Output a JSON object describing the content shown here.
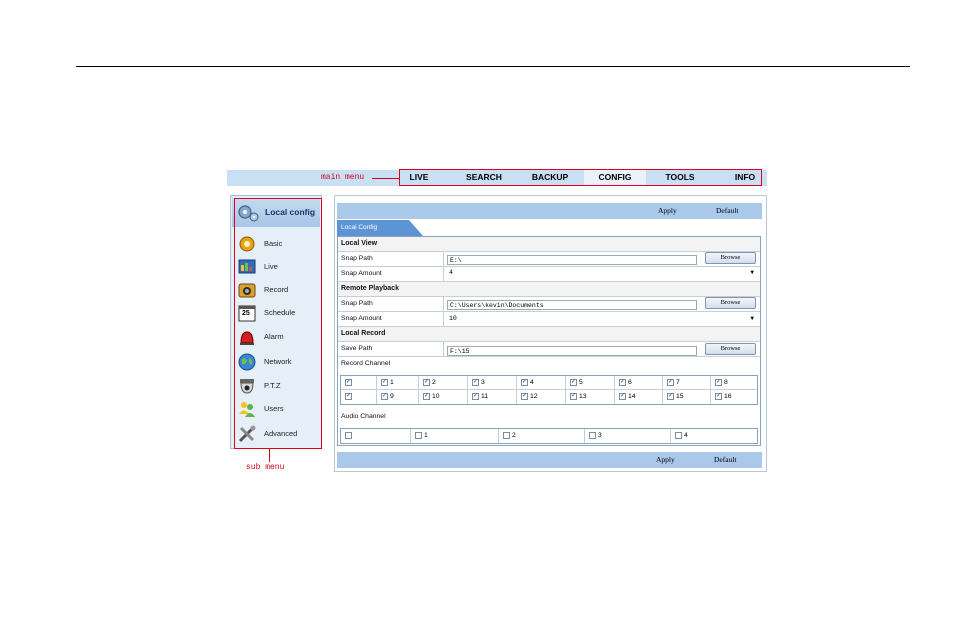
{
  "annotations": {
    "main_menu": "main menu",
    "sub_menu": "sub menu"
  },
  "main_menu": [
    {
      "label": "LIVE"
    },
    {
      "label": "SEARCH"
    },
    {
      "label": "BACKUP"
    },
    {
      "label": "CONFIG",
      "active": true
    },
    {
      "label": "TOOLS"
    },
    {
      "label": "INFO"
    }
  ],
  "sidebar": {
    "header": "Local config",
    "items": [
      {
        "label": "Basic",
        "icon": "gear-icon"
      },
      {
        "label": "Live",
        "icon": "monitor-icon"
      },
      {
        "label": "Record",
        "icon": "camera-icon"
      },
      {
        "label": "Schedule",
        "icon": "calendar-icon"
      },
      {
        "label": "Alarm",
        "icon": "siren-icon"
      },
      {
        "label": "Network",
        "icon": "globe-icon"
      },
      {
        "label": "P.T.Z",
        "icon": "dome-camera-icon"
      },
      {
        "label": "Users",
        "icon": "users-icon"
      },
      {
        "label": "Advanced",
        "icon": "tools-icon"
      }
    ],
    "calendar_day": "25"
  },
  "toolbar": {
    "apply": "Apply",
    "default": "Default"
  },
  "tab": "Local Config",
  "local_view": {
    "title": "Local View",
    "snap_path_label": "Snap Path",
    "snap_path": "E:\\",
    "snap_amount_label": "Snap Amount",
    "snap_amount": "4"
  },
  "remote_playback": {
    "title": "Remote Playback",
    "snap_path_label": "Snap Path",
    "snap_path": "C:\\Users\\kevin\\Documents",
    "snap_amount_label": "Snap Amount",
    "snap_amount": "10"
  },
  "local_record": {
    "title": "Local Record",
    "save_path_label": "Save Path",
    "save_path": "F:\\15",
    "record_channel_label": "Record Channel",
    "audio_channel_label": "Audio Channel"
  },
  "browse_label": "Browse",
  "record_channels_row1": [
    "1",
    "2",
    "3",
    "4",
    "5",
    "6",
    "7",
    "8"
  ],
  "record_channels_row2": [
    "9",
    "10",
    "11",
    "12",
    "13",
    "14",
    "15",
    "16"
  ],
  "audio_channels": [
    "1",
    "2",
    "3",
    "4"
  ]
}
